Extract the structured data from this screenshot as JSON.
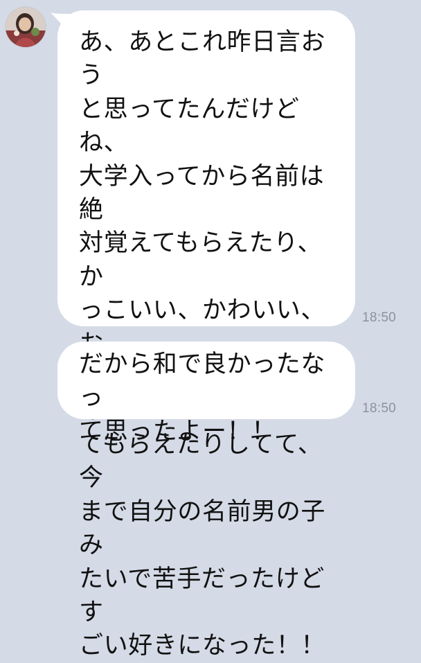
{
  "chat": {
    "messages": [
      {
        "sender": "incoming",
        "text": "あ、あとこれ昨日言おう\nと思ってたんだけどね、\n大学入ってから名前は絶\n対覚えてもらえたり、か\nっこいい、かわいい、お\nしゃれってたくさん褒め\nてもらえたりしてて、今\nまで自分の名前男の子み\nたいで苦手だったけどす\nごい好きになった！！",
        "time": "18:50"
      },
      {
        "sender": "incoming",
        "text": "だから和で良かったなっ\nて思ったよー！！",
        "time": "18:50"
      }
    ]
  },
  "colors": {
    "background": "#d4dae6",
    "bubble": "#ffffff",
    "text": "#111111",
    "timestamp": "#8b93a0"
  },
  "icons": {
    "avatar": "avatar-photo"
  }
}
